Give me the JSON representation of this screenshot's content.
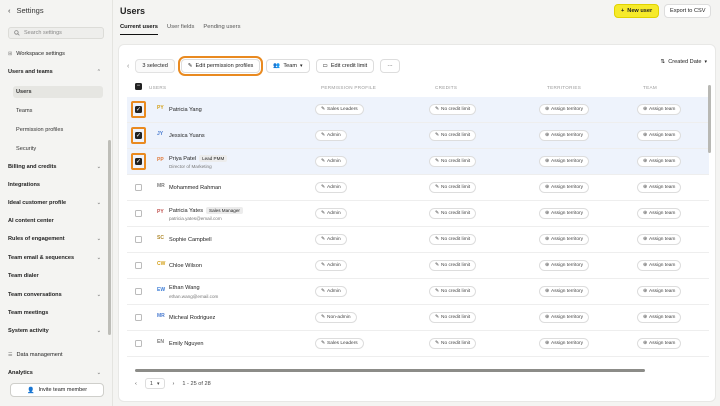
{
  "sidebar": {
    "back": "‹",
    "title": "Settings",
    "search_placeholder": "Search settings",
    "items": [
      {
        "label": "Workspace settings"
      },
      {
        "label": "Users and teams"
      },
      {
        "label": "Users"
      },
      {
        "label": "Teams"
      },
      {
        "label": "Permission profiles"
      },
      {
        "label": "Security"
      },
      {
        "label": "Billing and credits"
      },
      {
        "label": "Integrations"
      },
      {
        "label": "Ideal customer profile"
      },
      {
        "label": "AI content center"
      },
      {
        "label": "Rules of engagement"
      },
      {
        "label": "Team email & sequences"
      },
      {
        "label": "Team dialer"
      },
      {
        "label": "Team conversations"
      },
      {
        "label": "Team meetings"
      },
      {
        "label": "System activity"
      },
      {
        "label": "Data management"
      },
      {
        "label": "Analytics"
      }
    ],
    "invite": "Invite team member"
  },
  "header": {
    "title": "Users",
    "tabs": [
      "Current users",
      "User fields",
      "Pending users"
    ],
    "new_user": "New user",
    "export": "Export to CSV"
  },
  "toolbar": {
    "selected": "3 selected",
    "edit_permission": "Edit permission profiles",
    "team": "Team",
    "edit_credit": "Edit credit limit",
    "more": "···",
    "sort": "Created Date"
  },
  "columns": [
    "USERS",
    "PERMISSION PROFILE",
    "CREDITS",
    "TERRITORIES",
    "TEAM"
  ],
  "rows": [
    {
      "initials": "PY",
      "name": "Patricia Yang",
      "sub": "",
      "badge": "",
      "profile": "Sales Leaders",
      "credits": "No credit limit",
      "territory": "Assign territory",
      "team": "Assign team",
      "checked": true
    },
    {
      "initials": "JY",
      "name": "Jessica Yuans",
      "sub": "",
      "badge": "",
      "profile": "Admin",
      "credits": "No credit limit",
      "territory": "Assign territory",
      "team": "Assign team",
      "checked": true
    },
    {
      "initials": "PP",
      "name": "Priya Patel",
      "sub": "Director of Marketing",
      "badge": "Lead PMM",
      "profile": "Admin",
      "credits": "No credit limit",
      "territory": "Assign territory",
      "team": "Assign team",
      "checked": true
    },
    {
      "initials": "MR",
      "name": "Mohammed Rahman",
      "sub": "",
      "badge": "",
      "profile": "Admin",
      "credits": "No credit limit",
      "territory": "Assign territory",
      "team": "Assign team",
      "checked": false
    },
    {
      "initials": "PY",
      "name": "Patricia Yates",
      "sub": "patricia.yates@email.com",
      "badge": "Sales Manager",
      "profile": "Admin",
      "credits": "No credit limit",
      "territory": "Assign territory",
      "team": "Assign team",
      "checked": false
    },
    {
      "initials": "SC",
      "name": "Sophie Campbell",
      "sub": "",
      "badge": "",
      "profile": "Admin",
      "credits": "No credit limit",
      "territory": "Assign territory",
      "team": "Assign team",
      "checked": false
    },
    {
      "initials": "CW",
      "name": "Chloe Wilson",
      "sub": "",
      "badge": "",
      "profile": "Admin",
      "credits": "No credit limit",
      "territory": "Assign territory",
      "team": "Assign team",
      "checked": false
    },
    {
      "initials": "EW",
      "name": "Ethan Wang",
      "sub": "ethan.wang@email.com",
      "badge": "",
      "profile": "Admin",
      "credits": "No credit limit",
      "territory": "Assign territory",
      "team": "Assign team",
      "checked": false
    },
    {
      "initials": "MR",
      "name": "Micheal Rodriguez",
      "sub": "",
      "badge": "",
      "profile": "Non-admin",
      "credits": "No credit limit",
      "territory": "Assign territory",
      "team": "Assign team",
      "checked": false
    },
    {
      "initials": "EN",
      "name": "Emily Nguyen",
      "sub": "",
      "badge": "",
      "profile": "Sales Leaders",
      "credits": "No credit limit",
      "territory": "Assign territory",
      "team": "Assign team",
      "checked": false
    }
  ],
  "pager": {
    "page": "1",
    "range": "1 - 25 of 28",
    "prev": "‹",
    "next": "›"
  },
  "colors": {
    "accent": "#f6ea2a",
    "highlight": "#e98a20",
    "selected_row": "#eef3fc"
  }
}
